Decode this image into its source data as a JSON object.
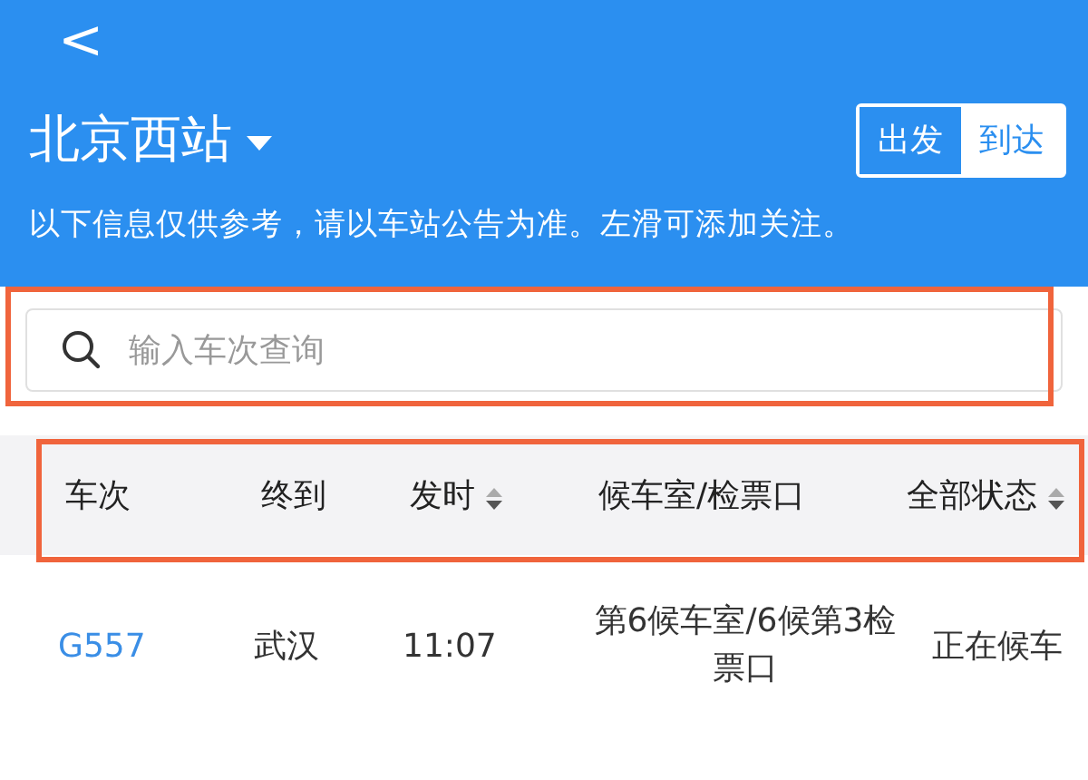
{
  "header": {
    "back": "<",
    "station": "北京西站",
    "toggle": [
      {
        "label": "出发",
        "selected": false
      },
      {
        "label": "到达",
        "selected": true
      }
    ],
    "notice": "以下信息仅供参考，请以车站公告为准。左滑可添加关注。"
  },
  "search": {
    "placeholder": "输入车次查询"
  },
  "table": {
    "columns": [
      {
        "label": "车次",
        "sortable": false
      },
      {
        "label": "终到",
        "sortable": false
      },
      {
        "label": "发时",
        "sortable": true
      },
      {
        "label": "候车室/检票口",
        "sortable": false
      },
      {
        "label": "全部状态",
        "sortable": true
      }
    ],
    "rows": [
      {
        "train": "G557",
        "destination": "武汉",
        "departure": "11:07",
        "gate": "第6候车室/6候第3检票口",
        "status": "正在候车"
      }
    ]
  }
}
